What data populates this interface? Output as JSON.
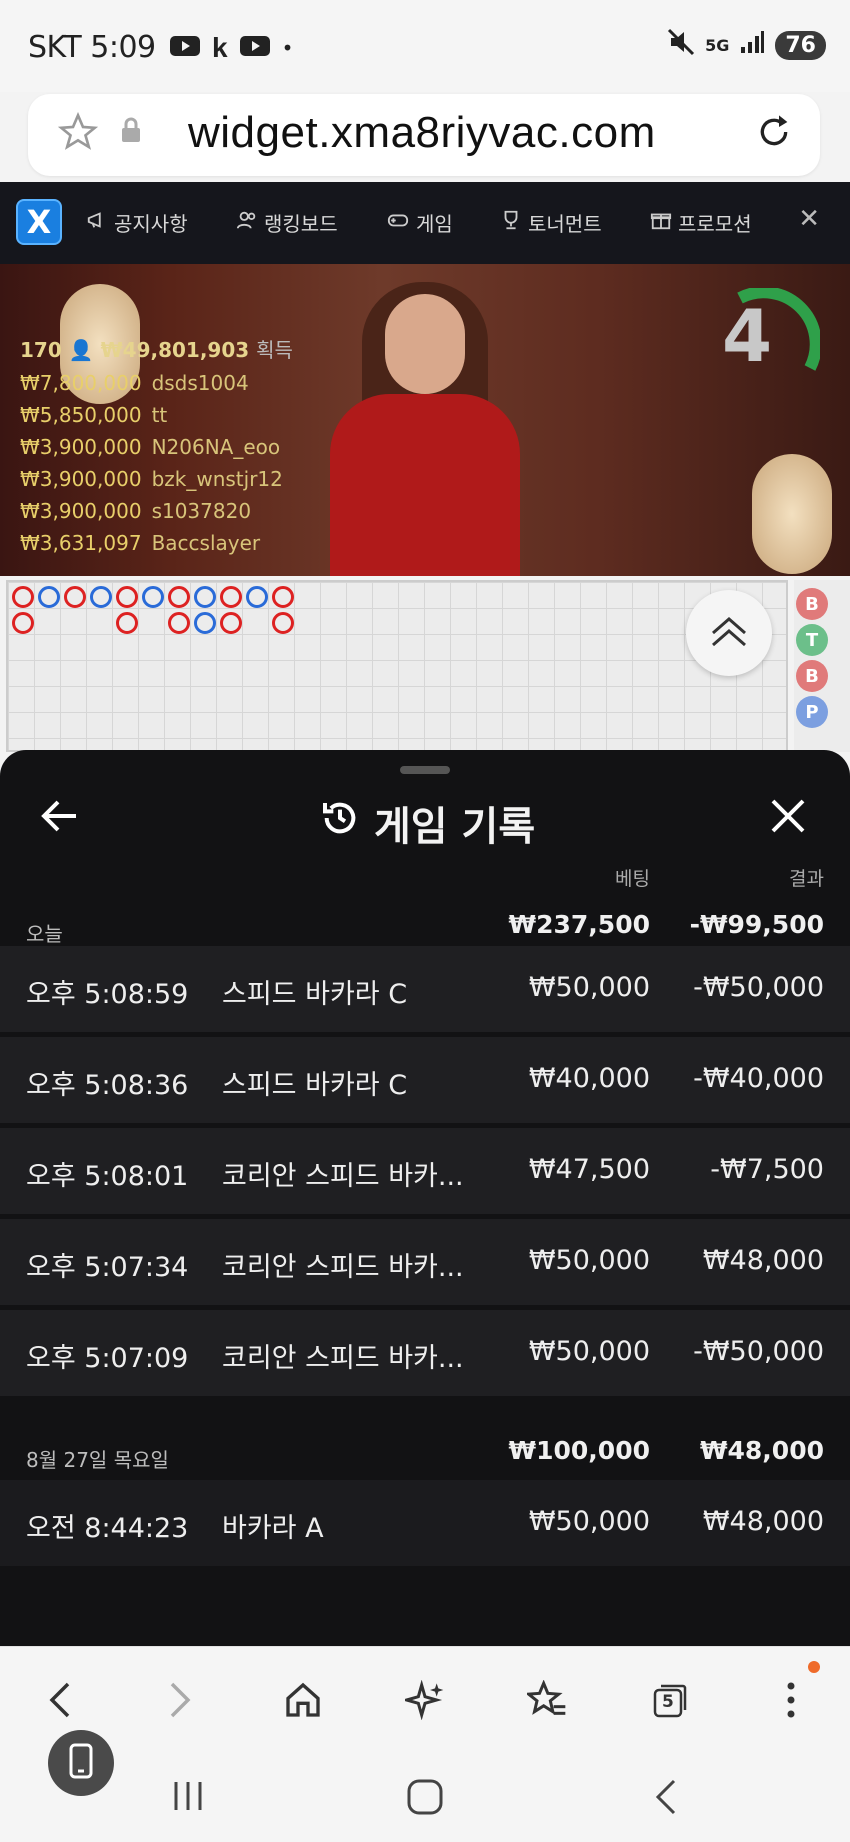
{
  "status": {
    "carrier_time": "SKT 5:09",
    "network": "5G",
    "battery": "76"
  },
  "browser": {
    "url": "widget.xma8riyvac.com",
    "tabs_count": "5"
  },
  "site_nav": {
    "items": [
      "공지사항",
      "랭킹보드",
      "게임",
      "토너먼트",
      "프로모션"
    ]
  },
  "video": {
    "winners_count": "170",
    "winners_total": "₩49,801,903",
    "winners_suffix": "획득",
    "winners": [
      {
        "amount": "₩7,800,000",
        "name": "dsds1004"
      },
      {
        "amount": "₩5,850,000",
        "name": "tt"
      },
      {
        "amount": "₩3,900,000",
        "name": "N206NA_eoo"
      },
      {
        "amount": "₩3,900,000",
        "name": "bzk_wnstjr12"
      },
      {
        "amount": "₩3,900,000",
        "name": "s1037820"
      },
      {
        "amount": "₩3,631,097",
        "name": "Baccslayer"
      }
    ],
    "timer": "4"
  },
  "scoreboard": {
    "side_labels": [
      "B",
      "T",
      "B",
      "P"
    ]
  },
  "history": {
    "title": "게임 기록",
    "col_bet": "베팅",
    "col_result": "결과",
    "groups": [
      {
        "label": "오늘",
        "bet_total": "₩237,500",
        "result_total": "-₩99,500",
        "rows": [
          {
            "time": "오후 5:08:59",
            "game": "스피드 바카라 C",
            "bet": "₩50,000",
            "result": "-₩50,000"
          },
          {
            "time": "오후 5:08:36",
            "game": "스피드 바카라 C",
            "bet": "₩40,000",
            "result": "-₩40,000"
          },
          {
            "time": "오후 5:08:01",
            "game": "코리안 스피드 바카...",
            "bet": "₩47,500",
            "result": "-₩7,500"
          },
          {
            "time": "오후 5:07:34",
            "game": "코리안 스피드 바카...",
            "bet": "₩50,000",
            "result": "₩48,000"
          },
          {
            "time": "오후 5:07:09",
            "game": "코리안 스피드 바카...",
            "bet": "₩50,000",
            "result": "-₩50,000"
          }
        ]
      },
      {
        "label": "8월 27일 목요일",
        "bet_total": "₩100,000",
        "result_total": "₩48,000",
        "rows": [
          {
            "time": "오전 8:44:23",
            "game": "바카라 A",
            "bet": "₩50,000",
            "result": "₩48,000"
          }
        ]
      }
    ]
  }
}
